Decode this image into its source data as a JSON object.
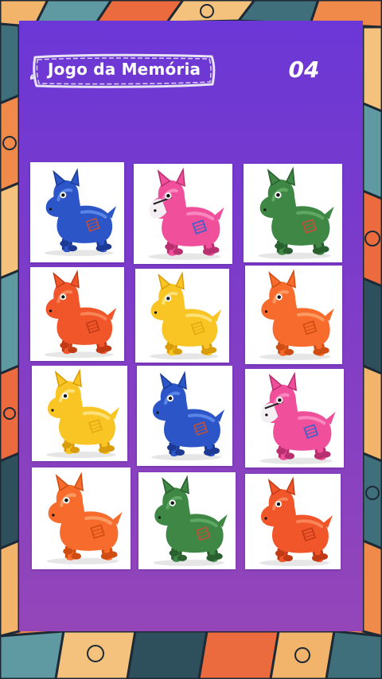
{
  "header": {
    "title": "Jogo da Memória",
    "counter": "04"
  },
  "colors": {
    "panel_top": "#6b37d6",
    "panel_bottom": "#9446b9",
    "title_outline": "#e8e2f5",
    "text": "#ffffff"
  },
  "cards": [
    {
      "toy": "bouncy-horse",
      "color": "blue"
    },
    {
      "toy": "bouncy-horse",
      "color": "pink"
    },
    {
      "toy": "bouncy-horse",
      "color": "green"
    },
    {
      "toy": "bouncy-horse",
      "color": "orange-red"
    },
    {
      "toy": "bouncy-horse",
      "color": "yellow"
    },
    {
      "toy": "bouncy-horse",
      "color": "orange"
    },
    {
      "toy": "bouncy-horse",
      "color": "yellow"
    },
    {
      "toy": "bouncy-horse",
      "color": "blue"
    },
    {
      "toy": "bouncy-horse",
      "color": "pink"
    },
    {
      "toy": "bouncy-horse",
      "color": "orange"
    },
    {
      "toy": "bouncy-horse",
      "color": "green"
    },
    {
      "toy": "bouncy-horse",
      "color": "orange-red"
    }
  ]
}
